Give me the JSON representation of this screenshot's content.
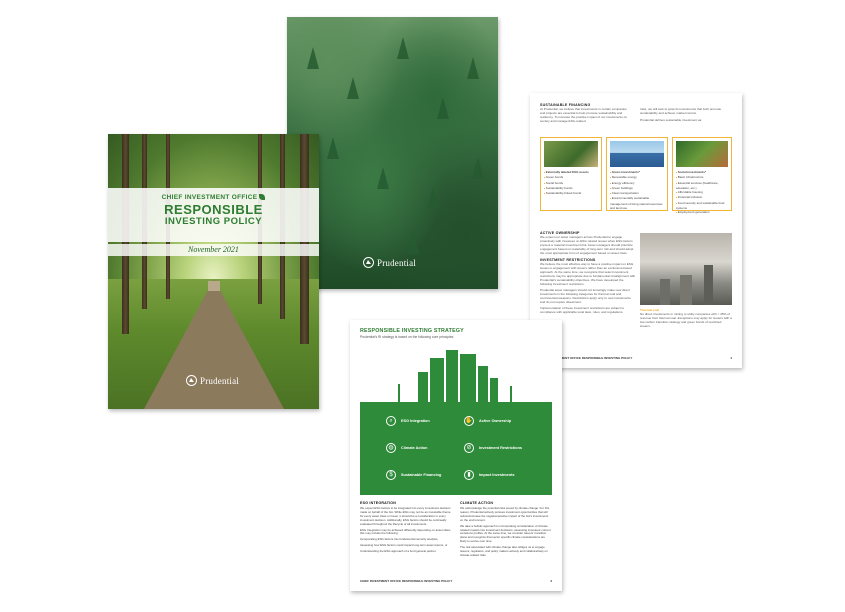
{
  "brand": {
    "logo_name": "Prudential",
    "accent_green": "#2e7d32",
    "panel_green": "#2e8b3a",
    "card_border": "#f2b53a"
  },
  "front_cover": {
    "office": "CHIEF INVESTMENT OFFICE",
    "title_line1": "RESPONSIBLE",
    "title_line2": "INVESTING POLICY",
    "date": "November 2021",
    "logo": "Prudential"
  },
  "back_cover": {
    "logo": "Prudential"
  },
  "right_page": {
    "sec1_title": "SUSTAINABLE FINANCING",
    "sec1_text": "At Prudential, we believe that investments in certain companies and projects are essential to help promote sustainability and resiliency. To increase the positive impact of our investments on society and manage ESG-related",
    "sec1_text_col2": "risks, we will look to grow its investments that both promote sustainability and achieve market returns.",
    "sec1_text_col2b": "Prudential defines sustainable investment as:",
    "cards": [
      {
        "title": "Externally labeled ESG assets",
        "items": [
          "Green bonds",
          "Social bonds",
          "Sustainability bonds",
          "Sustainability-linked bonds"
        ]
      },
      {
        "title": "Green investments*",
        "items": [
          "Renewable energy",
          "Energy efficiency",
          "Green buildings",
          "Clean transportation",
          "Environmentally sustainable management of living natural resources and land use"
        ]
      },
      {
        "title": "Social investments*",
        "items": [
          "Basic infrastructure",
          "Essential services (healthcare, education, etc.)",
          "Affordable housing",
          "Financial inclusion",
          "Food security and sustainable food systems",
          "Employment generation"
        ]
      }
    ],
    "sec2_title": "ACTIVE OWNERSHIP",
    "sec2_text": "We expect our asset managers across Prudential to engage proactively with investees on ESG-related issues when ESG factors present a material investment risk. Asset managers should prioritize engagement based on materiality of long-term risk and should adopt the most appropriate form of engagement based on asset class.",
    "sec3_title": "INVESTMENT RESTRICTIONS",
    "sec3_text": "We believe the most effective way to have a positive impact on ESG issues is engagement with issuers rather than an exclusions-based approach. At the same time, we recognize that select investment restrictions may be appropriate due to fundamental misalignment with Prudential's sustainability objectives. We have developed the following investment restrictions.",
    "sec3_text2": "Prudential asset managers should not knowingly make new direct investments in the following categories for thermal coal and controversial weapons. Restrictions apply only to new investments and do not require divestment.",
    "sec3_text3": "Implementation of these investment restrictions are subject to compliance with applicable local laws, rules, and regulations.",
    "photo_caption_title": "Thermal coal",
    "photo_caption": "No direct investments in mining or utility companies with > 25% of revenue from thermal coal. Exceptions may apply for issuers with a low carbon transition strategy and green bonds of restricted issuers.",
    "footer_left": "CHIEF INVESTMENT OFFICE RESPONSIBLE INVESTING POLICY",
    "footer_right": "4"
  },
  "strategy_page": {
    "title": "RESPONSIBLE INVESTING STRATEGY",
    "subtitle": "Prudential's RI strategy is based on the following core principles:",
    "items": [
      {
        "label": "ESG Integration",
        "icon": "search-icon"
      },
      {
        "label": "Active Ownership",
        "icon": "handshake-icon"
      },
      {
        "label": "Climate Action",
        "icon": "globe-icon"
      },
      {
        "label": "Investment Restrictions",
        "icon": "block-icon"
      },
      {
        "label": "Sustainable Financing",
        "icon": "coins-icon"
      },
      {
        "label": "Impact Investments",
        "icon": "chart-icon"
      }
    ],
    "col1_title": "ESG INTEGRATION",
    "col1_text": "We expect ESG factors to be integrated into every investment decision made on behalf of the GA. While ESG may not be an investable theme for every asset class or issuer, it should be a consideration in every investment decision. Additionally, ESG factors should be continually evaluated throughout the lifecycle of all investments.",
    "col1_text2": "ESG Integration may be achieved differently depending on asset class; this may include the following:",
    "col1_bullets": [
      "Incorporating ESG factors into fundamental security analysis,",
      "Assessing how ESG factors could impact long-term asset returns, or",
      "Understanding the ESG approach of a fund general partner."
    ],
    "col2_title": "CLIMATE ACTION",
    "col2_text": "We acknowledge the potential risks posed by climate change. For this reason, Prudential actively pursues investment opportunities that will reduce/increase the negative/positive impact of the GA's investments on the environment.",
    "col2_text2": "We take a holistic approach to incorporating consideration of climate-related impacts into investment decisions, assessing investees' current emissions profiles. At the same time, we consider issuers' transition plans and recognize that sector specific climate considerations are likely to evolve over time.",
    "col2_text3": "The risk associated with climate change also obliges us to engage issuers, regulators, and policy makers actively and collaboratively on climate-related risks.",
    "footer_left": "CHIEF INVESTMENT OFFICE RESPONSIBLE INVESTING POLICY",
    "footer_right": "3"
  }
}
